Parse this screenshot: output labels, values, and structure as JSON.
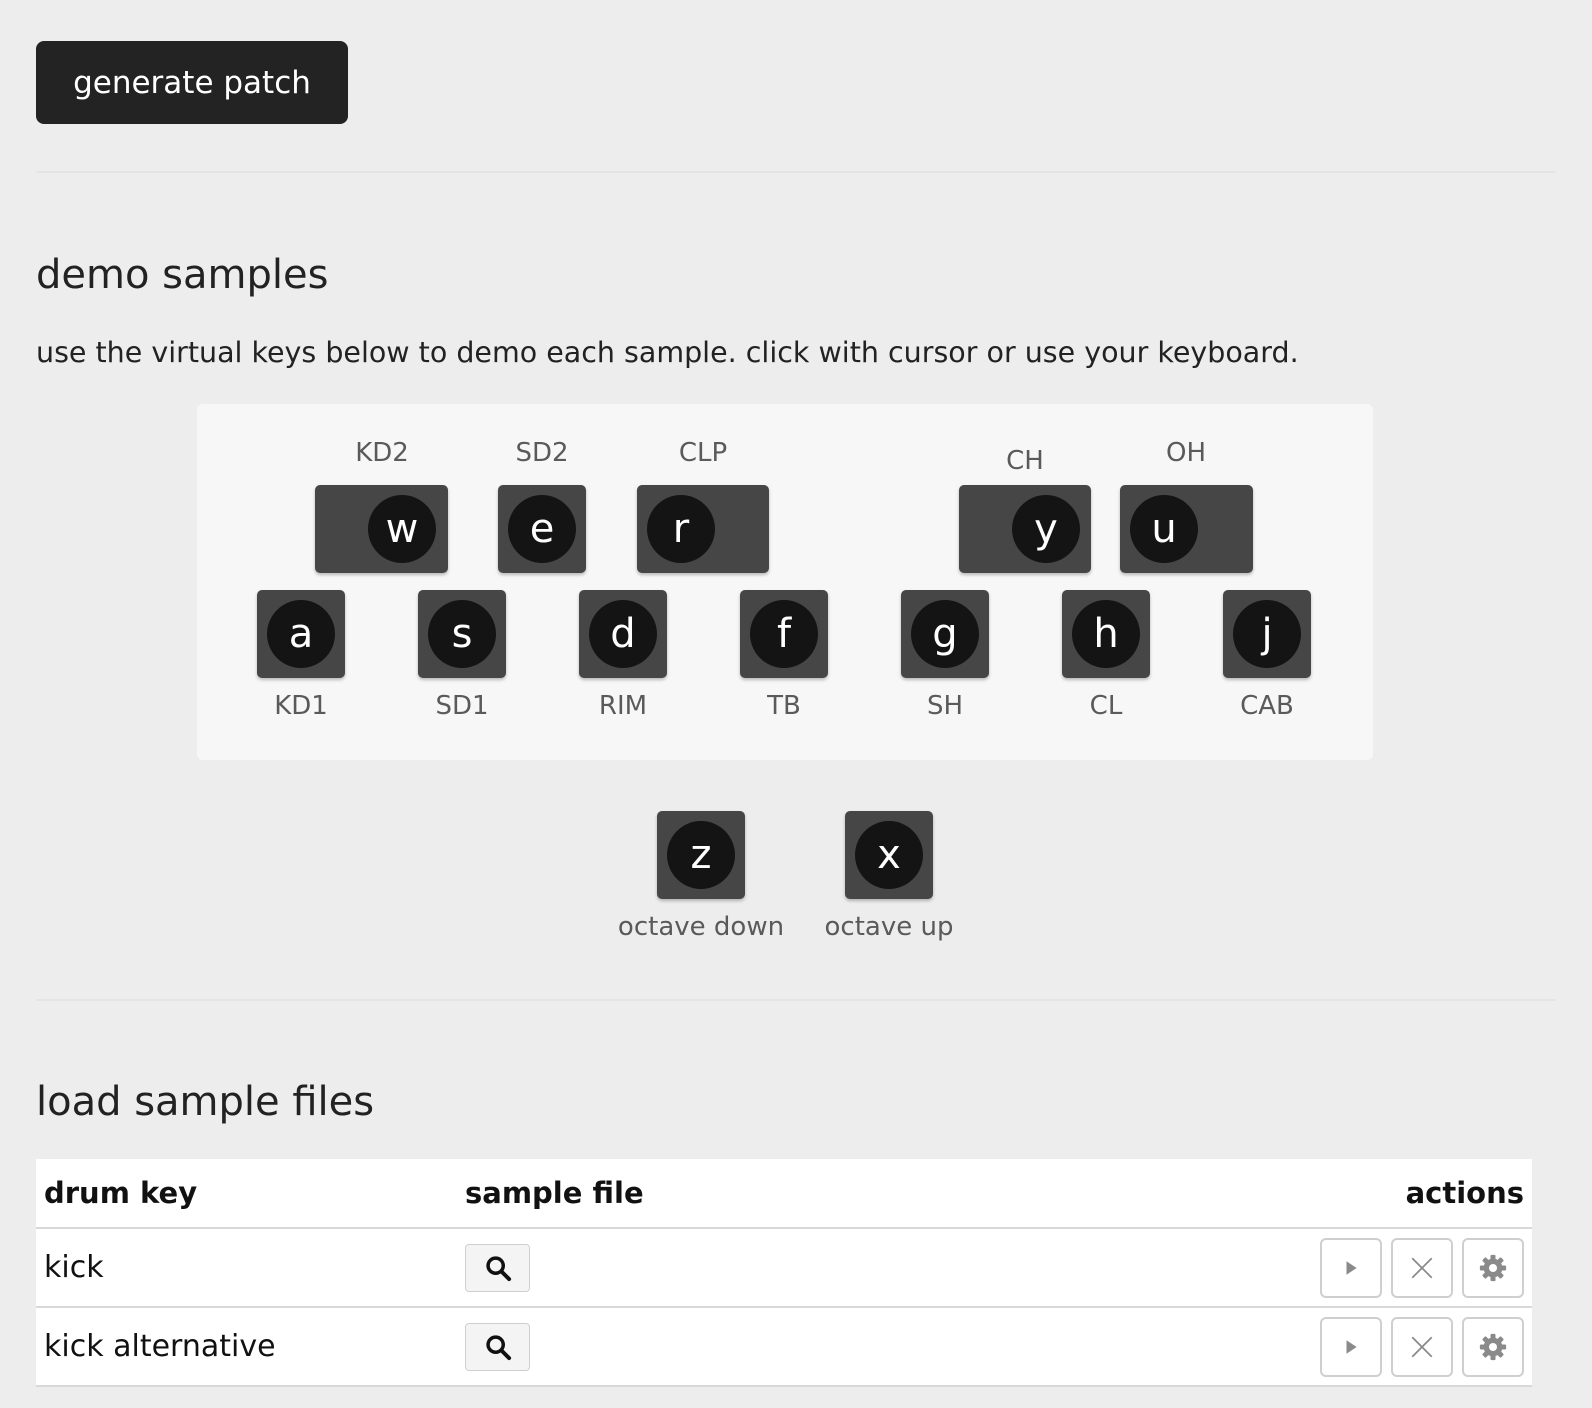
{
  "toolbar": {
    "generate_label": "generate patch"
  },
  "demo": {
    "title": "demo samples",
    "description": "use the virtual keys below to demo each sample. click with cursor or use your keyboard.",
    "upper_keys": [
      {
        "key": "w",
        "label": "KD2"
      },
      {
        "key": "e",
        "label": "SD2"
      },
      {
        "key": "r",
        "label": "CLP"
      },
      {
        "key": "y",
        "label": "CH"
      },
      {
        "key": "u",
        "label": "OH"
      }
    ],
    "lower_keys": [
      {
        "key": "a",
        "label": "KD1"
      },
      {
        "key": "s",
        "label": "SD1"
      },
      {
        "key": "d",
        "label": "RIM"
      },
      {
        "key": "f",
        "label": "TB"
      },
      {
        "key": "g",
        "label": "SH"
      },
      {
        "key": "h",
        "label": "CL"
      },
      {
        "key": "j",
        "label": "CAB"
      }
    ],
    "octave_keys": [
      {
        "key": "z",
        "label": "octave down"
      },
      {
        "key": "x",
        "label": "octave up"
      }
    ]
  },
  "load": {
    "title": "load sample files",
    "columns": {
      "drum_key": "drum key",
      "sample_file": "sample file",
      "actions": "actions"
    },
    "rows": [
      {
        "drum_key": "kick"
      },
      {
        "drum_key": "kick alternative"
      }
    ]
  },
  "icons": {
    "browse": "search-icon",
    "play": "play-icon",
    "clear": "close-icon",
    "settings": "gear-icon"
  },
  "colors": {
    "background": "#ededed",
    "key": "#464646",
    "key_cap": "#141414",
    "button": "#232323"
  }
}
